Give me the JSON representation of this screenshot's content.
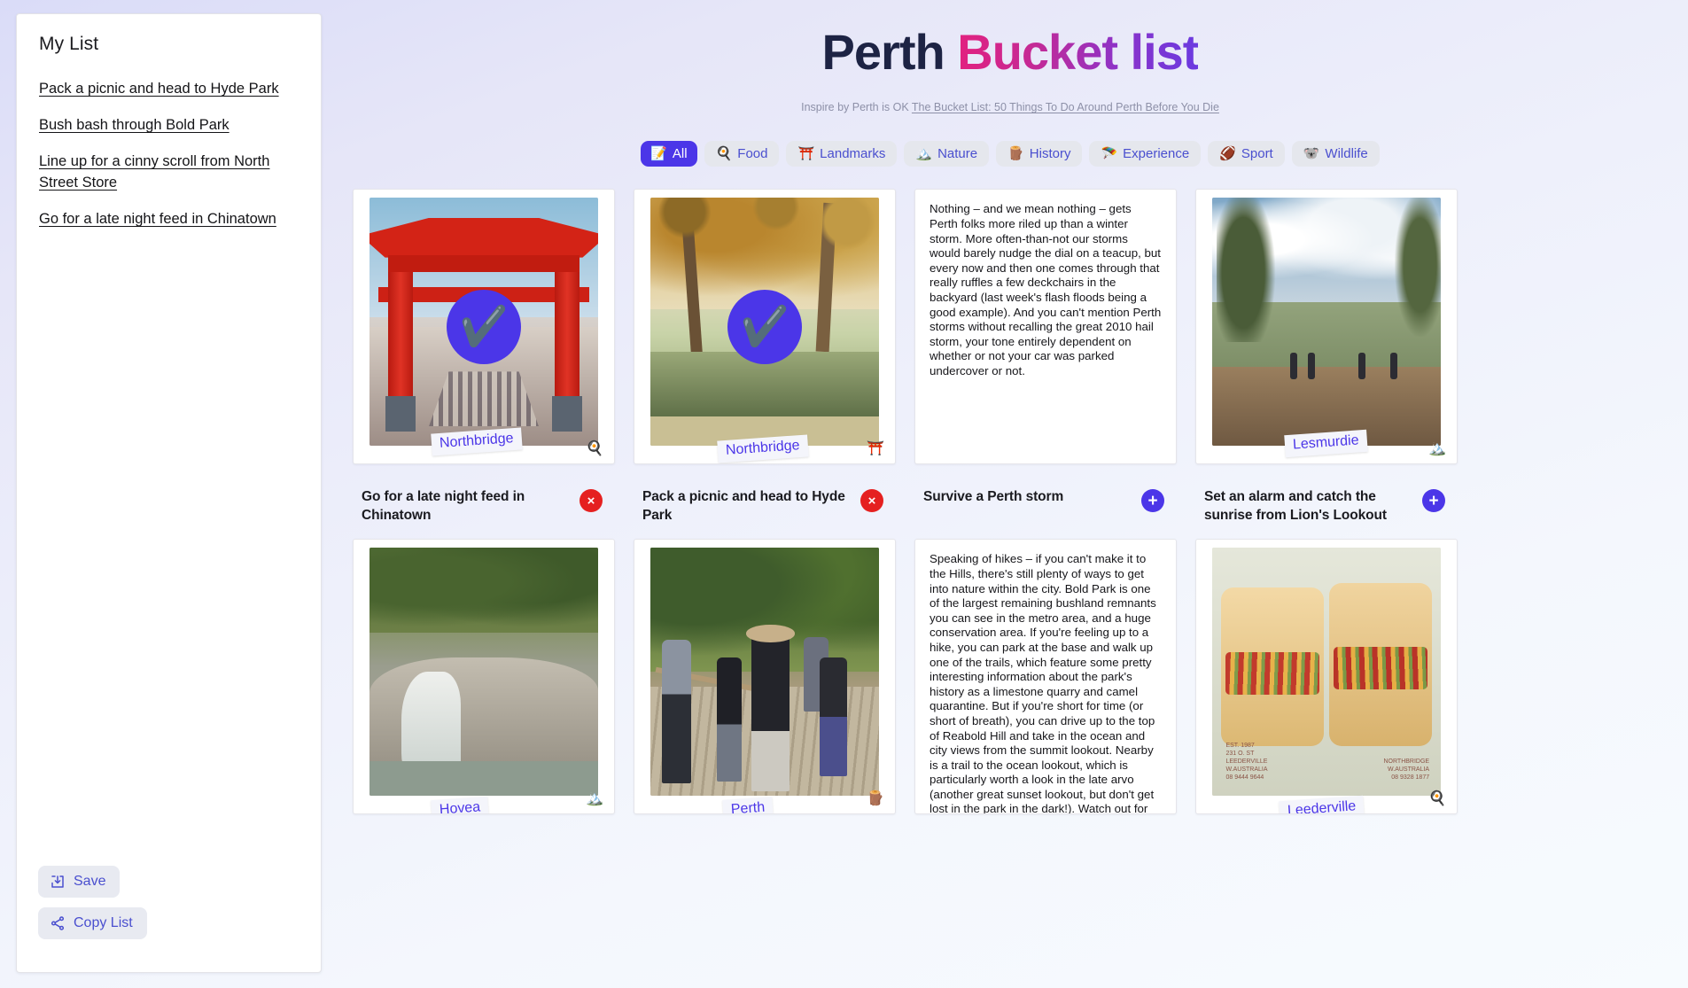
{
  "sidebar": {
    "title": "My List",
    "items": [
      "Pack a picnic and head to Hyde Park",
      "Bush bash through Bold Park",
      "Line up for a cinny scroll from North Street Store",
      "Go for a late night feed in Chinatown"
    ],
    "actions": {
      "save_label": "Save",
      "save_icon": "save-download-icon",
      "copy_label": "Copy List",
      "copy_icon": "share-nodes-icon"
    }
  },
  "header": {
    "title_part1": "Perth ",
    "title_part2": "Bucket list",
    "subtitle_prefix": "Inspire by Perth is OK ",
    "subtitle_link": "The Bucket List: 50 Things To Do Around Perth Before You Die",
    "gradient_start": "#e2217f",
    "gradient_end": "#6b3ae0"
  },
  "tabs": [
    {
      "label": "All",
      "emoji": "📝",
      "icon": "memo-icon",
      "active": true
    },
    {
      "label": "Food",
      "emoji": "🍳",
      "icon": "cooking-icon",
      "active": false
    },
    {
      "label": "Landmarks",
      "emoji": "⛩️",
      "icon": "shinto-shrine-icon",
      "active": false
    },
    {
      "label": "Nature",
      "emoji": "🏔️",
      "icon": "snow-mountain-icon",
      "active": false
    },
    {
      "label": "History",
      "emoji": "🪵",
      "icon": "wood-icon",
      "active": false
    },
    {
      "label": "Experience",
      "emoji": "🪂",
      "icon": "parachute-icon",
      "active": false
    },
    {
      "label": "Sport",
      "emoji": "🏈",
      "icon": "football-icon",
      "active": false
    },
    {
      "label": "Wildlife",
      "emoji": "🐨",
      "icon": "koala-icon",
      "active": false
    }
  ],
  "cards": [
    {
      "kind": "photo",
      "photo": "ph-gate",
      "checked": true,
      "check_emoji": "✔️",
      "location": "Northbridge",
      "category_emoji": "🍳",
      "category_icon": "cooking-icon",
      "title": "Go for a late night feed in Chinatown",
      "action": "remove",
      "action_label": "×"
    },
    {
      "kind": "photo",
      "photo": "ph-park",
      "checked": true,
      "check_emoji": "✔️",
      "location": "Northbridge",
      "category_emoji": "⛩️",
      "category_icon": "shinto-shrine-icon",
      "title": "Pack a picnic and head to Hyde Park",
      "action": "remove",
      "action_label": "×"
    },
    {
      "kind": "text",
      "body": "Nothing – and we mean nothing – gets Perth folks more riled up than a winter storm. More often-than-not our storms would barely nudge the dial on a teacup, but every now and then one comes through that really ruffles a few deckchairs in the backyard (last week's flash floods being a good example). And you can't mention Perth storms without recalling the great 2010 hail storm, your tone entirely dependent on whether or not your car was parked undercover or not.",
      "checked": false,
      "title": "Survive a Perth storm",
      "action": "add",
      "action_label": "+"
    },
    {
      "kind": "photo",
      "photo": "ph-look",
      "checked": false,
      "location": "Lesmurdie",
      "category_emoji": "🏔️",
      "category_icon": "snow-mountain-icon",
      "title": "Set an alarm and catch the sunrise from Lion's Lookout",
      "action": "add",
      "action_label": "+"
    },
    {
      "kind": "photo",
      "photo": "ph-falls",
      "checked": false,
      "location": "Hovea",
      "category_emoji": "🏔️",
      "category_icon": "snow-mountain-icon",
      "title": "",
      "action": "none",
      "action_label": ""
    },
    {
      "kind": "photo",
      "photo": "ph-walk",
      "checked": false,
      "location": "Perth",
      "category_emoji": "🪵",
      "category_icon": "wood-icon",
      "title": "",
      "action": "none",
      "action_label": ""
    },
    {
      "kind": "text",
      "body": "Speaking of hikes – if you can't make it to the Hills, there's still plenty of ways to get into nature within the city. Bold Park is one of the largest remaining bushland remnants you can see in the metro area, and a huge conservation area. If you're feeling up to a hike, you can park at the base and walk up one of the trails, which feature some pretty interesting information about the park's history as a limestone quarry and camel quarantine. But if you're short for time (or short of breath), you can drive up to the top of Reabold Hill and take in the ocean and city views from the summit lookout. Nearby is a trail to the ocean lookout, which is particularly worth a look in the late arvo (another great sunset lookout, but don't get lost in the park in the dark!). Watch out for snakes!",
      "checked": false,
      "title": "",
      "action": "none",
      "action_label": ""
    },
    {
      "kind": "photo",
      "photo": "ph-roll",
      "checked": false,
      "location": "Leederville",
      "category_emoji": "🍳",
      "category_icon": "cooking-icon",
      "title": "",
      "action": "none",
      "action_label": ""
    }
  ],
  "roll_image_text": {
    "left_line1": "EST. 1987",
    "left_line2": "231 O. ST",
    "left_line3": "LEEDERVILLE",
    "left_line4": "W.AUSTRALIA",
    "left_line5": "08 9444 9644",
    "right_line1": "NORTHBRIDGE",
    "right_line2": "W.AUSTRALIA",
    "right_line3": "08 9328 1877"
  }
}
